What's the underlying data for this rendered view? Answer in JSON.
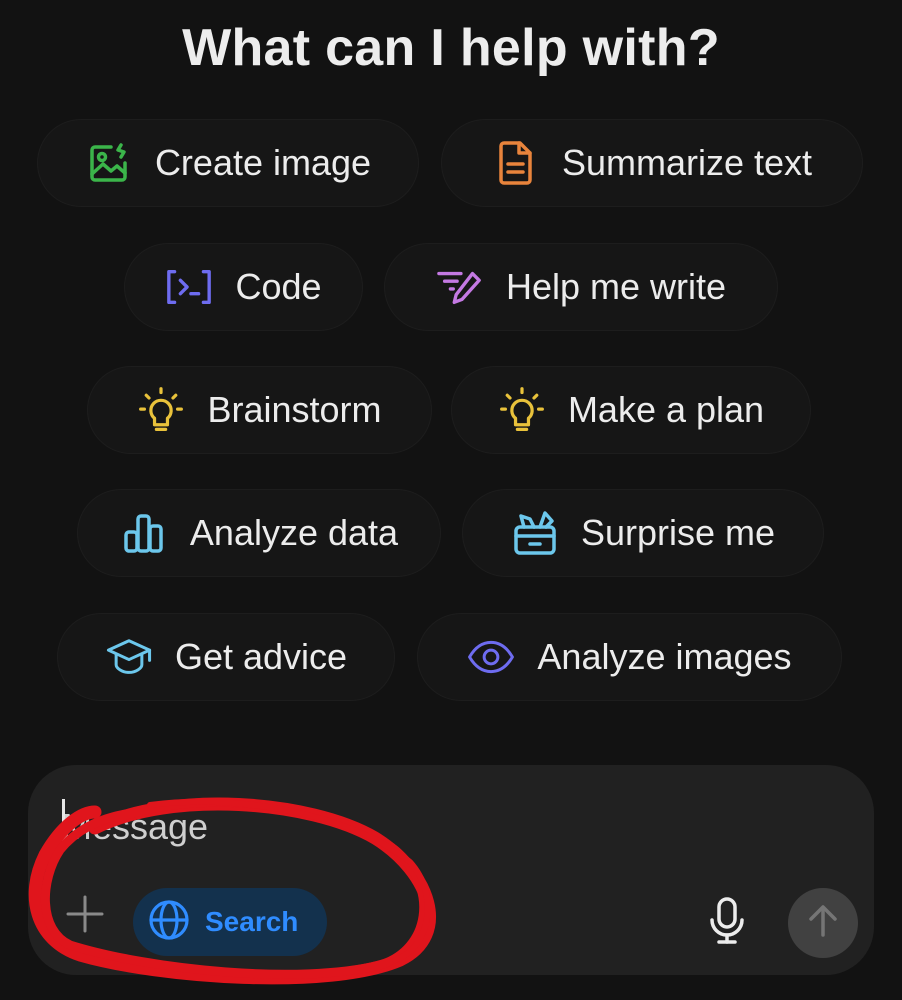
{
  "heading": "What can I help with?",
  "suggestions": [
    {
      "label": "Create image",
      "icon": "create-image-icon",
      "color": "#3bb54a"
    },
    {
      "label": "Summarize text",
      "icon": "document-icon",
      "color": "#e8843c"
    },
    {
      "label": "Code",
      "icon": "code-icon",
      "color": "#6e6cf0"
    },
    {
      "label": "Help me write",
      "icon": "pen-icon",
      "color": "#c479e3"
    },
    {
      "label": "Brainstorm",
      "icon": "lightbulb-icon",
      "color": "#e9c23b"
    },
    {
      "label": "Make a plan",
      "icon": "lightbulb-icon",
      "color": "#e9c23b"
    },
    {
      "label": "Analyze data",
      "icon": "bar-chart-icon",
      "color": "#6cc7ec"
    },
    {
      "label": "Surprise me",
      "icon": "gift-box-icon",
      "color": "#6cc7ec"
    },
    {
      "label": "Get advice",
      "icon": "graduation-cap-icon",
      "color": "#6cc7ec"
    },
    {
      "label": "Analyze images",
      "icon": "eye-icon",
      "color": "#6e6cf0"
    }
  ],
  "composer": {
    "placeholder": "Message",
    "search_label": "Search",
    "search_color": "#2f8cff"
  },
  "annotation_color": "#e0151c"
}
